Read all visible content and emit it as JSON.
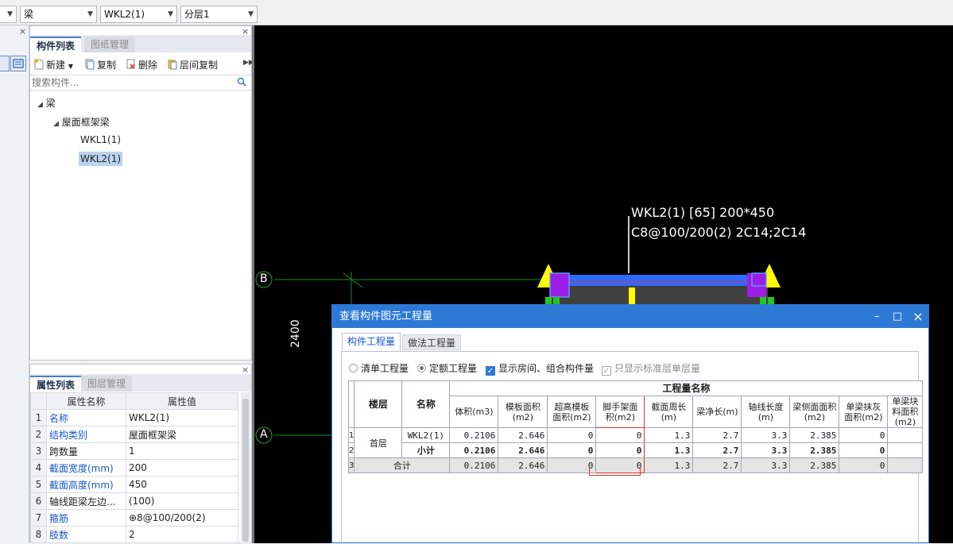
{
  "topbar": {
    "selects": [
      {
        "value": ""
      },
      {
        "value": "梁"
      },
      {
        "value": "WKL2(1)"
      },
      {
        "value": "分层1"
      }
    ]
  },
  "component_panel": {
    "tabs": [
      "构件列表",
      "图纸管理"
    ],
    "toolbar": {
      "new": "新建",
      "copy": "复制",
      "delete": "删除",
      "floor_copy": "层间复制"
    },
    "search_placeholder": "搜索构件...",
    "tree": {
      "root": "梁",
      "group": "屋面框架梁",
      "items": [
        "WKL1(1)",
        "WKL2(1)"
      ]
    }
  },
  "property_panel": {
    "tabs": [
      "属性列表",
      "图层管理"
    ],
    "headers": [
      "属性名称",
      "属性值"
    ],
    "rows": [
      {
        "n": "1",
        "name": "名称",
        "value": "WKL2(1)"
      },
      {
        "n": "2",
        "name": "结构类别",
        "value": "屋面框架梁"
      },
      {
        "n": "3",
        "name": "跨数量",
        "value": "1"
      },
      {
        "n": "4",
        "name": "截面宽度(mm)",
        "value": "200"
      },
      {
        "n": "5",
        "name": "截面高度(mm)",
        "value": "450"
      },
      {
        "n": "6",
        "name": "轴线距梁左边...",
        "value": "(100)"
      },
      {
        "n": "7",
        "name": "箍筋",
        "value": "⊕8@100/200(2)"
      },
      {
        "n": "8",
        "name": "肢数",
        "value": "2"
      }
    ]
  },
  "canvas": {
    "beam_label_line1": "WKL2(1) [65] 200*450",
    "beam_label_line2": "C8@100/200(2) 2C14;2C14",
    "axis_b": "B",
    "axis_a": "A",
    "dimension": "2400",
    "colors": {
      "axis": "#1f8a1f",
      "beam": "#2d6bff",
      "support": "#ffff00",
      "column": "#9b1ee6"
    }
  },
  "dialog": {
    "title": "查看构件图元工程量",
    "controls": {
      "minimize": "–",
      "maximize": "□",
      "close": "×"
    },
    "tabs": [
      "构件工程量",
      "做法工程量"
    ],
    "options": {
      "list_qty": "清单工程量",
      "quota_qty": "定额工程量",
      "show_room": "显示房间、组合构件量",
      "only_std": "只显示标准层单层量"
    },
    "table": {
      "group_header": "工程量名称",
      "col_floor": "楼层",
      "col_name": "名称",
      "columns": [
        "体积(m3)",
        "模板面积(m2)",
        "超高模板面积(m2)",
        "脚手架面积(m2)",
        "截面周长(m)",
        "梁净长(m)",
        "轴线长度(m)",
        "梁侧面面积(m2)",
        "单梁抹灰面积(m2)",
        "单梁块料面积(m2)"
      ],
      "floor_value": "首层",
      "rows": [
        {
          "n": "1",
          "name": "WKL2(1)",
          "values": [
            "0.2106",
            "2.646",
            "0",
            "0",
            "1.3",
            "2.7",
            "3.3",
            "2.385",
            "0",
            ""
          ]
        },
        {
          "n": "2",
          "name": "小计",
          "values": [
            "0.2106",
            "2.646",
            "0",
            "0",
            "1.3",
            "2.7",
            "3.3",
            "2.385",
            "0",
            ""
          ]
        },
        {
          "n": "3",
          "name": "合计",
          "values": [
            "0.2106",
            "2.646",
            "0",
            "0",
            "1.3",
            "2.7",
            "3.3",
            "2.385",
            "0",
            ""
          ]
        }
      ]
    }
  }
}
